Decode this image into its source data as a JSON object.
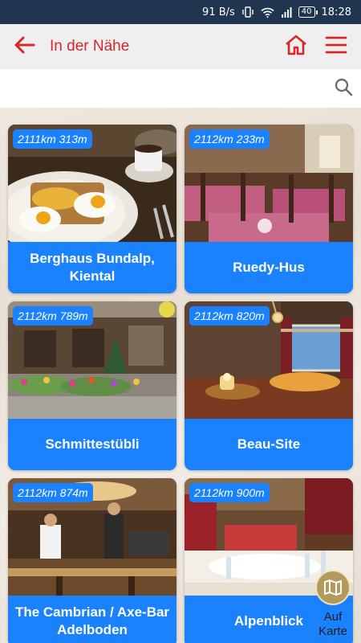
{
  "status_bar": {
    "network_speed": "91 B/s",
    "battery": "40",
    "time": "18:28"
  },
  "app_bar": {
    "title": "In der Nähe",
    "accent_color": "#d9262b"
  },
  "search": {
    "placeholder": "",
    "value": ""
  },
  "restaurants": [
    {
      "distance": "2111km 313m",
      "name": "Berghaus Bundalp, Kiental"
    },
    {
      "distance": "2112km 233m",
      "name": "Ruedy-Hus"
    },
    {
      "distance": "2112km 789m",
      "name": "Schmittestübli"
    },
    {
      "distance": "2112km 820m",
      "name": "Beau-Site"
    },
    {
      "distance": "2112km 874m",
      "name": "The Cambrian / Axe-Bar Adelboden"
    },
    {
      "distance": "2112km 900m",
      "name": "Alpenblick"
    }
  ],
  "map_button": {
    "label": "Auf Karte",
    "icon": "map-icon"
  },
  "colors": {
    "card_blue": "#1a82ff",
    "status_bar": "#1f3550",
    "map_gold": "#b19a5b"
  }
}
